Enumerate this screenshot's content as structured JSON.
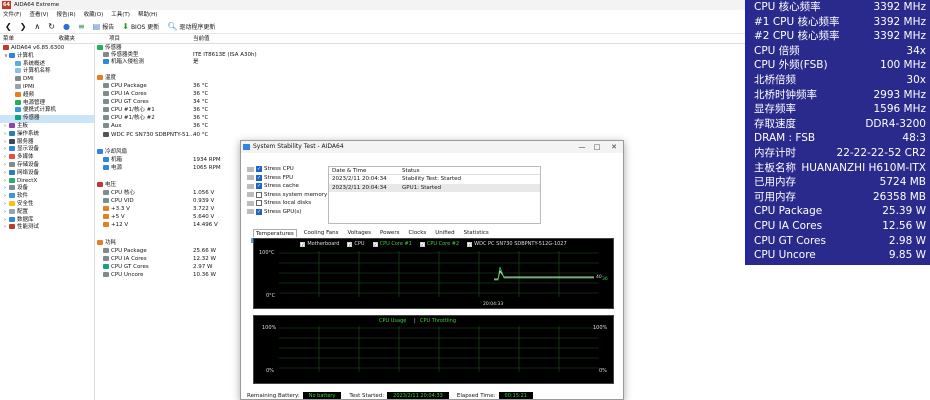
{
  "window": {
    "title": "AIDA64 Extreme",
    "menu": [
      "文件(F)",
      "查看(V)",
      "报告(R)",
      "收藏(O)",
      "工具(T)",
      "帮助(H)"
    ],
    "toolbar": {
      "report": "报告",
      "bios": "BIOS 更新",
      "driver": "驱动程序更新"
    }
  },
  "sidebar": {
    "col1": "菜单",
    "col2": "收藏夹",
    "items": [
      {
        "label": "AIDA64 v6.85.6300",
        "indent": 0,
        "icon": "app-icon"
      },
      {
        "label": "计算机",
        "indent": 1,
        "icon": "computer-icon"
      },
      {
        "label": "系统概述",
        "indent": 2,
        "icon": "summary-icon"
      },
      {
        "label": "计算机名称",
        "indent": 2,
        "icon": "computer-name-icon"
      },
      {
        "label": "DMI",
        "indent": 2,
        "icon": "dmi-icon"
      },
      {
        "label": "IPMI",
        "indent": 2,
        "icon": "ipmi-icon"
      },
      {
        "label": "超频",
        "indent": 2,
        "icon": "overclock-icon"
      },
      {
        "label": "电源管理",
        "indent": 2,
        "icon": "power-icon"
      },
      {
        "label": "便携式计算机",
        "indent": 2,
        "icon": "laptop-icon"
      },
      {
        "label": "传感器",
        "indent": 2,
        "icon": "sensor-icon",
        "selected": true
      },
      {
        "label": "主板",
        "indent": 1,
        "icon": "motherboard-icon"
      },
      {
        "label": "操作系统",
        "indent": 1,
        "icon": "os-icon"
      },
      {
        "label": "服务器",
        "indent": 1,
        "icon": "server-icon"
      },
      {
        "label": "显示设备",
        "indent": 1,
        "icon": "display-icon"
      },
      {
        "label": "多媒体",
        "indent": 1,
        "icon": "multimedia-icon"
      },
      {
        "label": "存储设备",
        "indent": 1,
        "icon": "storage-icon"
      },
      {
        "label": "网络设备",
        "indent": 1,
        "icon": "network-icon"
      },
      {
        "label": "DirectX",
        "indent": 1,
        "icon": "directx-icon"
      },
      {
        "label": "设备",
        "indent": 1,
        "icon": "device-icon"
      },
      {
        "label": "软件",
        "indent": 1,
        "icon": "software-icon"
      },
      {
        "label": "安全性",
        "indent": 1,
        "icon": "security-icon"
      },
      {
        "label": "配置",
        "indent": 1,
        "icon": "config-icon"
      },
      {
        "label": "数据库",
        "indent": 1,
        "icon": "database-icon"
      },
      {
        "label": "性能测试",
        "indent": 1,
        "icon": "benchmark-icon"
      }
    ]
  },
  "detail": {
    "col_item": "项目",
    "col_value": "当前值",
    "rows": [
      {
        "label": "传感器",
        "value": "",
        "section": true
      },
      {
        "label": "传感器类型",
        "value": "ITE IT8613E  (ISA A30h)"
      },
      {
        "label": "机箱入侵检测",
        "value": "是"
      },
      {
        "label": "温度",
        "value": "",
        "section": true
      },
      {
        "label": "CPU Package",
        "value": "36 °C"
      },
      {
        "label": "CPU IA Cores",
        "value": "36 °C"
      },
      {
        "label": "CPU GT Cores",
        "value": "34 °C"
      },
      {
        "label": "CPU #1/核心 #1",
        "value": "36 °C"
      },
      {
        "label": "CPU #1/核心 #2",
        "value": "36 °C"
      },
      {
        "label": "Aux",
        "value": "36 °C"
      },
      {
        "label": "WDC PC SN730 SDBPNTY-51...",
        "value": "40 °C"
      },
      {
        "label": "冷却风扇",
        "value": "",
        "section": true
      },
      {
        "label": "机箱",
        "value": "1934 RPM"
      },
      {
        "label": "电源",
        "value": "1065 RPM"
      },
      {
        "label": "电压",
        "value": "",
        "section": true
      },
      {
        "label": "CPU 核心",
        "value": "1.056 V"
      },
      {
        "label": "CPU VID",
        "value": "0.939 V"
      },
      {
        "label": "+3.3 V",
        "value": "3.722 V"
      },
      {
        "label": "+5 V",
        "value": "5.640 V"
      },
      {
        "label": "+12 V",
        "value": "14.496 V"
      },
      {
        "label": "功耗",
        "value": "",
        "section": true
      },
      {
        "label": "CPU Package",
        "value": "25.66 W"
      },
      {
        "label": "CPU IA Cores",
        "value": "12.32 W"
      },
      {
        "label": "CPU GT Cores",
        "value": "2.97 W"
      },
      {
        "label": "CPU Uncore",
        "value": "10.36 W"
      }
    ]
  },
  "dialog": {
    "title": "System Stability Test - AIDA64",
    "stress_items": [
      {
        "label": "Stress CPU",
        "checked": true
      },
      {
        "label": "Stress FPU",
        "checked": true
      },
      {
        "label": "Stress cache",
        "checked": true
      },
      {
        "label": "Stress system memory",
        "checked": false
      },
      {
        "label": "Stress local disks",
        "checked": false
      },
      {
        "label": "Stress GPU(s)",
        "checked": true
      }
    ],
    "log": {
      "col_date": "Date & Time",
      "col_status": "Status",
      "rows": [
        {
          "date": "2023/2/11 20:04:34",
          "status": "Stability Test: Started"
        },
        {
          "date": "2023/2/11 20:04:34",
          "status": "GPU1: Started"
        }
      ]
    },
    "tabs": [
      "Temperatures",
      "Cooling Fans",
      "Voltages",
      "Powers",
      "Clocks",
      "Unified",
      "Statistics"
    ],
    "graph1": {
      "legend": [
        {
          "label": "Motherboard",
          "color": "#ffffff"
        },
        {
          "label": "CPU",
          "color": "#ffffff"
        },
        {
          "label": "CPU Core #1",
          "color": "#3cd13c"
        },
        {
          "label": "CPU Core #2",
          "color": "#3cd13c"
        },
        {
          "label": "WDC PC SN730 SDBPNTY-512G-1027",
          "color": "#ffffff"
        }
      ],
      "y_top": "100°C",
      "y_bottom": "0°C",
      "time": "20:04:33",
      "right_values": [
        "40",
        "36"
      ]
    },
    "graph2": {
      "legend_a": "CPU Usage",
      "legend_sep": "|",
      "legend_b": "CPU Throttling",
      "y_top": "100%",
      "y_bottom": "0%",
      "right_top": "100%",
      "right_bottom": "0%"
    },
    "status": {
      "battery_label": "Remaining Battery:",
      "battery_value": "No battery",
      "started_label": "Test Started:",
      "started_value": "2023/2/11 20:04:33",
      "elapsed_label": "Elapsed Time:",
      "elapsed_value": "00:15:21"
    }
  },
  "osd": {
    "rows": [
      {
        "label": "CPU 核心频率",
        "value": "3392 MHz"
      },
      {
        "label": "#1 CPU 核心频率",
        "value": "3392 MHz"
      },
      {
        "label": "#2 CPU 核心频率",
        "value": "3392 MHz"
      },
      {
        "label": "CPU 倍频",
        "value": "34x"
      },
      {
        "label": "CPU 外频(FSB)",
        "value": "100 MHz"
      },
      {
        "label": "北桥倍频",
        "value": "30x"
      },
      {
        "label": "北桥时钟频率",
        "value": "2993 MHz"
      },
      {
        "label": "显存频率",
        "value": "1596 MHz"
      },
      {
        "label": "存取速度",
        "value": "DDR4-3200"
      },
      {
        "label": "DRAM : FSB",
        "value": "48:3"
      },
      {
        "label": "内存计时",
        "value": "22-22-22-52 CR2"
      },
      {
        "label": "主板名称",
        "value": "HUANANZHI H610M-ITX"
      },
      {
        "label": "已用内存",
        "value": "5724 MB"
      },
      {
        "label": "可用内存",
        "value": "26358 MB"
      },
      {
        "label": "CPU Package",
        "value": "25.39 W"
      },
      {
        "label": "CPU IA Cores",
        "value": "12.56 W"
      },
      {
        "label": "CPU GT Cores",
        "value": "2.98 W"
      },
      {
        "label": "CPU Uncore",
        "value": "9.85 W"
      }
    ]
  }
}
